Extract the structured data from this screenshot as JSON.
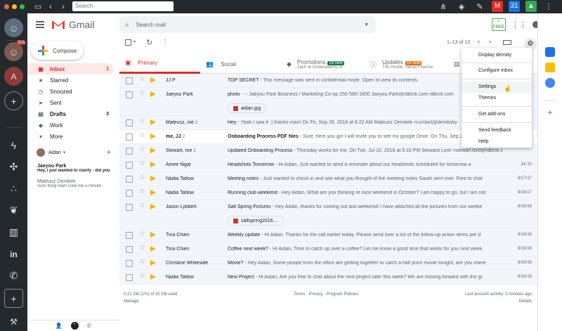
{
  "browser": {
    "search_placeholder": "Search"
  },
  "app": {
    "name": "Gmail",
    "compose_label": "Compose",
    "search_placeholder": "Search mail",
    "accent": "#d93025"
  },
  "rail": {
    "badge": "203",
    "letter": "A"
  },
  "nav": [
    {
      "icon": "inbox-icon",
      "label": "Inbox",
      "count": "1"
    },
    {
      "icon": "star-icon",
      "label": "Starred",
      "count": ""
    },
    {
      "icon": "clock-icon",
      "label": "Snoozed",
      "count": ""
    },
    {
      "icon": "send-icon",
      "label": "Sent",
      "count": ""
    },
    {
      "icon": "draft-icon",
      "label": "Drafts",
      "count": "3"
    },
    {
      "icon": "label-icon",
      "label": "Work",
      "count": ""
    },
    {
      "icon": "chevron-down-icon",
      "label": "More",
      "count": ""
    }
  ],
  "hangouts": {
    "user": "Aidan",
    "chats": [
      {
        "name": "Jaeyou Park",
        "preview": "Hey, I just wanted to clarify - did you"
      },
      {
        "name": "Mateusz Dembek",
        "preview": "Sure thing man! Give me a minute."
      }
    ]
  },
  "toolbar": {
    "pagination": "1–13 of 13"
  },
  "tabs": [
    {
      "label": "Primary",
      "badge": "",
      "sub": ""
    },
    {
      "label": "Social",
      "badge": "",
      "sub": ""
    },
    {
      "label": "Promotions",
      "badge": "18 new",
      "sub": "Zach at Codecademy, in"
    },
    {
      "label": "Updates",
      "badge": "15 new",
      "sub": "The Hustle, Yahoo Finance"
    }
  ],
  "emails": [
    {
      "sender": "JJ P",
      "count": "",
      "subject": "TOP SECRET",
      "snippet": " - This message was sent in confidential mode. Open to view its contents.",
      "date": "",
      "unread": false,
      "attachment": ""
    },
    {
      "sender": "Jaeyou Park",
      "count": "",
      "subject": "photo",
      "snippet": " - -- Jaeyou Park Business / Marketing Co-op 250-590-1800 Jaeyou.Park@rdbrck.com rdbrck.com",
      "date": "",
      "unread": false,
      "attachment": "aidan.jpg"
    },
    {
      "sender": "Mateusz, me",
      "count": "2",
      "subject": "Hey",
      "snippet": " - Yeah I saw it :) thanks man! On Fri, Sep 28, 2018 at 8:22 AM Mateusz Dembek <contact@dembsky",
      "date": "",
      "unread": false,
      "attachment": ""
    },
    {
      "sender": "me, JJ",
      "count": "2",
      "subject": "Onboarding Process PDF files",
      "snippet": " - Sure, here you go! I will invite you to see my google Drive. On Thu, Sep 27",
      "date": "",
      "unread": true,
      "attachment": ""
    },
    {
      "sender": "Stewart, me",
      "count": "2",
      "subject": "Updated Onboarding Process",
      "snippet": " - Thursday works for me. On Tue, Jul 10, 2018 at 6:10 PM Steward Lord <stewart.lord@rdbrck.c",
      "date": "",
      "unread": false,
      "attachment": ""
    },
    {
      "sender": "Amee Nijjar",
      "count": "",
      "subject": "Headshots Tomorrow",
      "snippet": " - Hi Aidan, Just wanted to send a reminder about our headshots scheduled for tomorrow a",
      "date": "Jul 10",
      "unread": false,
      "attachment": ""
    },
    {
      "sender": "Nadia Tatlow",
      "count": "",
      "subject": "Meeting notes",
      "snippet": " - Just wanted to check in and see what you thought of the meeting notes Sarah sent over. Free to chat",
      "date": "8/17/17",
      "unread": false,
      "attachment": ""
    },
    {
      "sender": "Nadia Tatlow",
      "count": "",
      "subject": "Running club weekend",
      "snippet": " - Hey Aidan, What are you thinking re race weekend in October? I am happy to go, but I am not",
      "date": "8/16/17",
      "unread": false,
      "attachment": ""
    },
    {
      "sender": "Jason Lybbert",
      "count": "",
      "subject": "Salt Spring Pictures",
      "snippet": " - Hey Aidan, thanks for coming out last weekend! I have attached all the pictures from our weeke",
      "date": "8/16/16",
      "unread": false,
      "attachment": "saltspring2016...."
    },
    {
      "sender": "Tina Chien",
      "count": "",
      "subject": "Weekly update",
      "snippet": " - Hi Aidan, Thanks for the call earlier today. Please send over a list of the follow-up action items per d",
      "date": "8/16/16",
      "unread": false,
      "attachment": ""
    },
    {
      "sender": "Tina Chien",
      "count": "",
      "subject": "Coffee next week?",
      "snippet": " - Hi Aidan, Time to catch up over a coffee? Let me know a good time that works for you next week.",
      "date": "8/16/16",
      "unread": false,
      "attachment": ""
    },
    {
      "sender": "Christine Whiteside",
      "count": "",
      "subject": "Movie?",
      "snippet": " - Hey Aidan, Some people from the office are getting together to catch a half price movie tonight, are you intere",
      "date": "8/16/16",
      "unread": false,
      "attachment": ""
    },
    {
      "sender": "Nadia Tatlow",
      "count": "",
      "subject": "New Project",
      "snippet": " - Hi Aidan, Are you free to chat about the next project later this week? We are moving forward with the gr",
      "date": "8/16/16",
      "unread": false,
      "attachment": ""
    }
  ],
  "footer": {
    "storage": "0.21 GB (1%) of 15 GB used",
    "manage": "Manage",
    "links": "Terms · Privacy · Program Policies",
    "activity": "Last account activity: 0 minutes ago",
    "details": "Details"
  },
  "settings_menu": {
    "items": [
      "Display density",
      "Configure inbox",
      "Settings",
      "Themes",
      "Get add-ons",
      "Send feedback",
      "Help"
    ],
    "hovered": "Settings"
  }
}
